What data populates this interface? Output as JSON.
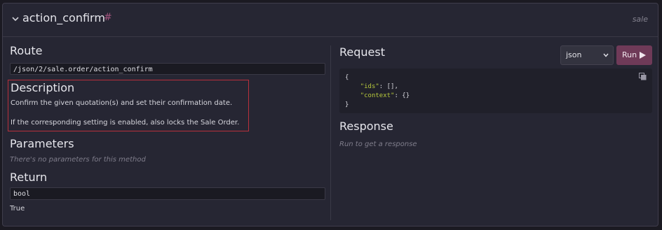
{
  "header": {
    "title": "action_confirm",
    "hash": "#",
    "tag": "sale"
  },
  "route": {
    "heading": "Route",
    "path": "/json/2/sale.order/action_confirm"
  },
  "description": {
    "heading": "Description",
    "paragraph1": "Confirm the given quotation(s) and set their confirmation date.",
    "paragraph2": "If the corresponding setting is enabled, also locks the Sale Order."
  },
  "parameters": {
    "heading": "Parameters",
    "empty_text": "There's no parameters for this method"
  },
  "return": {
    "heading": "Return",
    "type": "bool",
    "value": "True"
  },
  "request": {
    "heading": "Request",
    "format_selected": "json",
    "run_label": "Run",
    "code": {
      "open": "{",
      "line1_key": "\"ids\"",
      "line1_rest": ": [],",
      "line2_key": "\"context\"",
      "line2_rest": ": {}",
      "close": "}"
    }
  },
  "response": {
    "heading": "Response",
    "empty_text": "Run to get a response"
  },
  "colors": {
    "accent": "#6f3a58",
    "highlight_border": "#b8303c",
    "json_key": "#b7c93c"
  }
}
